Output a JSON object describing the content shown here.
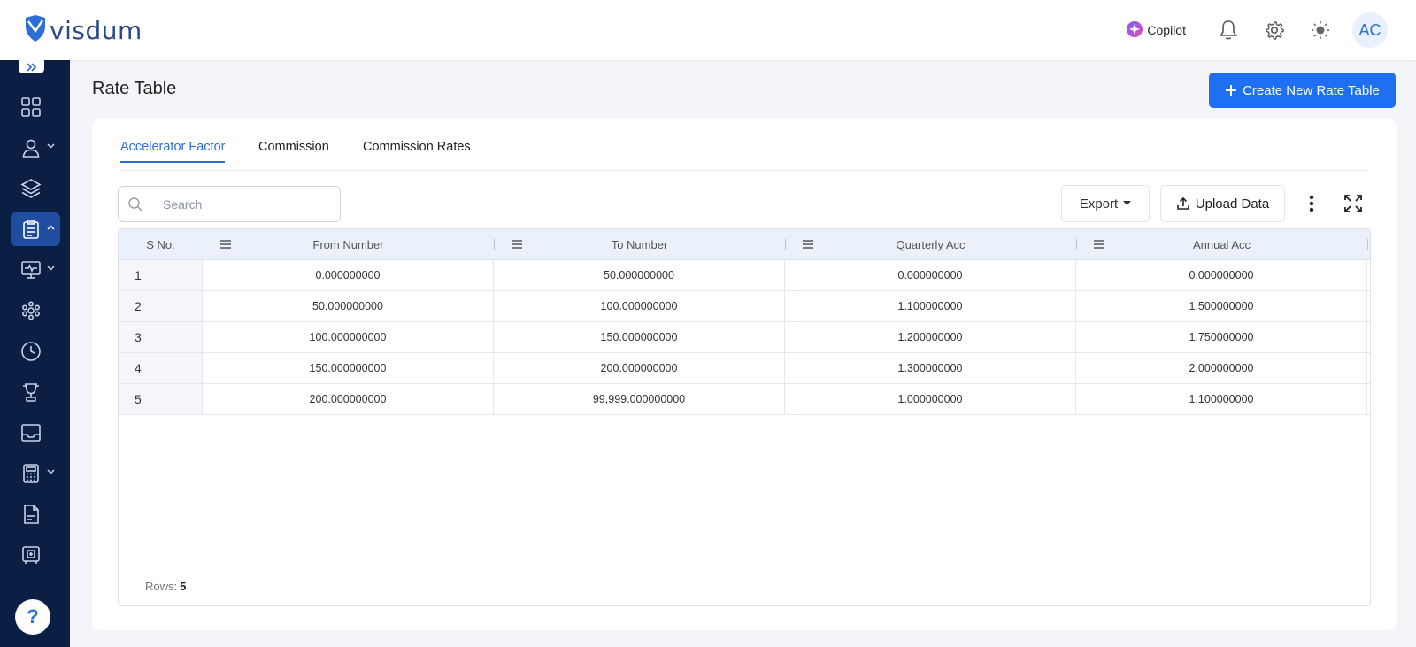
{
  "brand": {
    "name": "visdum"
  },
  "header": {
    "copilot_label": "Copilot",
    "avatar_initials": "AC",
    "icons": [
      "bell-icon",
      "gear-icon",
      "sun-icon"
    ]
  },
  "sidebar": {
    "items": [
      {
        "icon": "dashboard-grid-icon",
        "has_chevron": false,
        "active": false
      },
      {
        "icon": "user-icon",
        "has_chevron": true,
        "active": false
      },
      {
        "icon": "layers-icon",
        "has_chevron": false,
        "active": false
      },
      {
        "icon": "clipboard-icon",
        "has_chevron": true,
        "active": true
      },
      {
        "icon": "monitor-pulse-icon",
        "has_chevron": true,
        "active": false
      },
      {
        "icon": "team-icon",
        "has_chevron": false,
        "active": false
      },
      {
        "icon": "clock-icon",
        "has_chevron": false,
        "active": false
      },
      {
        "icon": "trophy-icon",
        "has_chevron": false,
        "active": false
      },
      {
        "icon": "inbox-icon",
        "has_chevron": false,
        "active": false
      },
      {
        "icon": "calculator-icon",
        "has_chevron": true,
        "active": false
      },
      {
        "icon": "document-icon",
        "has_chevron": false,
        "active": false
      },
      {
        "icon": "safe-icon",
        "has_chevron": false,
        "active": false
      }
    ],
    "help_label": "?"
  },
  "page": {
    "title": "Rate Table",
    "create_button_label": "Create New Rate Table"
  },
  "tabs": [
    {
      "label": "Accelerator Factor",
      "active": true
    },
    {
      "label": "Commission",
      "active": false
    },
    {
      "label": "Commission Rates",
      "active": false
    }
  ],
  "toolbar": {
    "search_placeholder": "Search",
    "export_label": "Export",
    "upload_label": "Upload Data"
  },
  "table": {
    "columns": [
      "S No.",
      "From Number",
      "To Number",
      "Quarterly Acc",
      "Annual Acc"
    ],
    "rows": [
      [
        "1",
        "0.000000000",
        "50.000000000",
        "0.000000000",
        "0.000000000"
      ],
      [
        "2",
        "50.000000000",
        "100.000000000",
        "1.100000000",
        "1.500000000"
      ],
      [
        "3",
        "100.000000000",
        "150.000000000",
        "1.200000000",
        "1.750000000"
      ],
      [
        "4",
        "150.000000000",
        "200.000000000",
        "1.300000000",
        "2.000000000"
      ],
      [
        "5",
        "200.000000000",
        "99,999.000000000",
        "1.000000000",
        "1.100000000"
      ]
    ],
    "footer_label": "Rows:",
    "row_count": "5"
  },
  "colors": {
    "sidebar_bg": "#0b1f45",
    "accent": "#1f6ff2",
    "active_nav": "#1f4ea0",
    "table_header_bg": "#eaf1fb"
  }
}
